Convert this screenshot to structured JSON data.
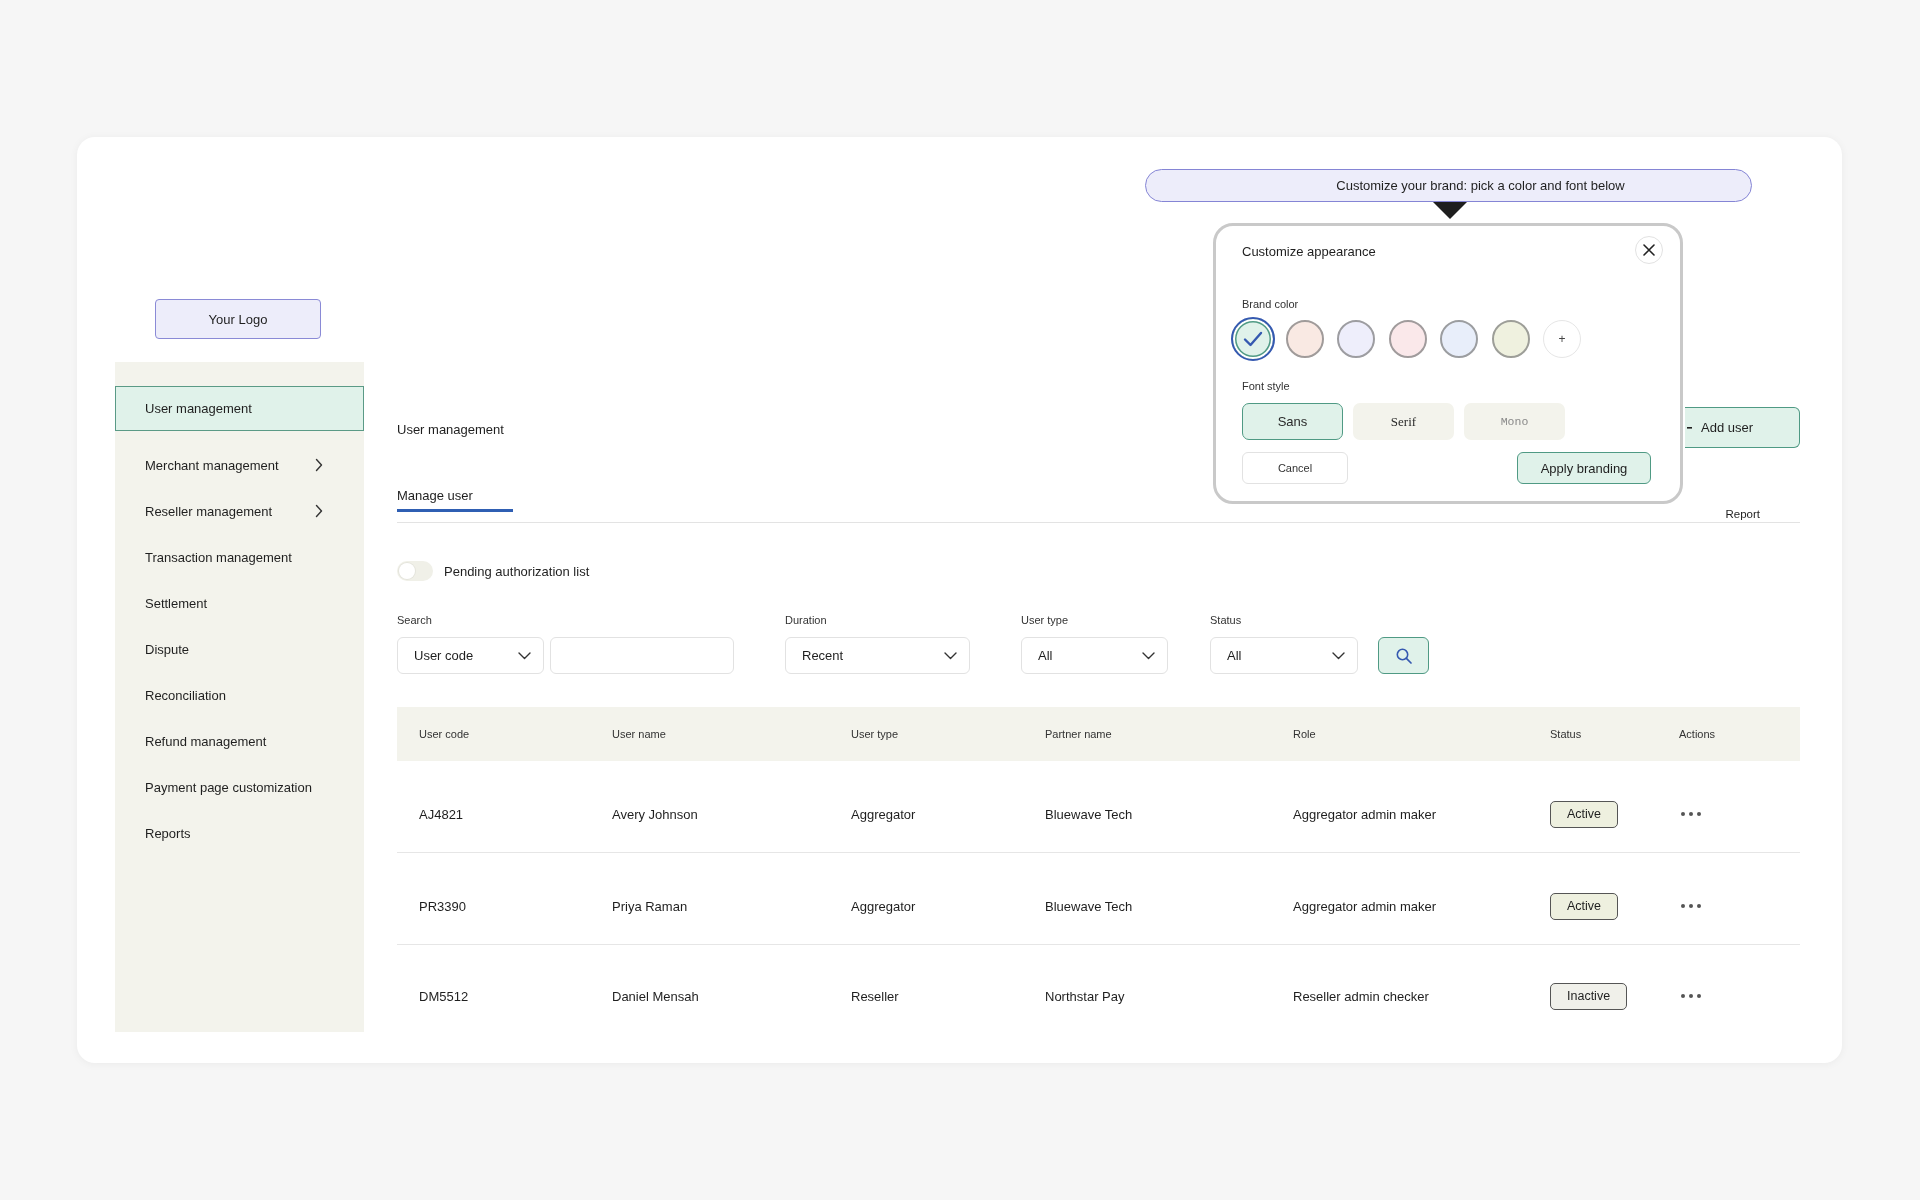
{
  "tooltip": {
    "text": "Customize your brand: pick a color and font below"
  },
  "appearance_dialog": {
    "title": "Customize appearance",
    "brand_color_label": "Brand color",
    "colors": [
      {
        "color": "#e0f2ea",
        "selected": true
      },
      {
        "color": "#f9e9e3",
        "selected": false
      },
      {
        "color": "#eeeefb",
        "selected": false
      },
      {
        "color": "#fae8ea",
        "selected": false
      },
      {
        "color": "#e8eefa",
        "selected": false
      },
      {
        "color": "#eff1df",
        "selected": false
      }
    ],
    "add_color_label": "+",
    "font_style_label": "Font style",
    "font_styles": [
      {
        "kind": "sans",
        "label": "Sans",
        "selected": true,
        "disabled": false
      },
      {
        "kind": "serif",
        "label": "Serif",
        "selected": false,
        "disabled": false
      },
      {
        "kind": "mono",
        "label": "Mono",
        "selected": false,
        "disabled": true
      }
    ],
    "buttons": [
      {
        "kind": "secondary",
        "label": "Cancel"
      },
      {
        "kind": "primary",
        "label": "Apply branding"
      }
    ]
  },
  "logo": {
    "label": "Your Logo"
  },
  "sidebar": {
    "items": [
      {
        "label": "User management",
        "selected": true,
        "has_submenu": false
      },
      {
        "label": "Merchant management",
        "selected": false,
        "has_submenu": true
      },
      {
        "label": "Reseller management",
        "selected": false,
        "has_submenu": true
      },
      {
        "label": "Transaction management",
        "selected": false,
        "has_submenu": false
      },
      {
        "label": "Settlement",
        "selected": false,
        "has_submenu": false
      },
      {
        "label": "Dispute",
        "selected": false,
        "has_submenu": false
      },
      {
        "label": "Reconciliation",
        "selected": false,
        "has_submenu": false
      },
      {
        "label": "Refund management",
        "selected": false,
        "has_submenu": false
      },
      {
        "label": "Payment page customization",
        "selected": false,
        "has_submenu": false
      },
      {
        "label": "Reports",
        "selected": false,
        "has_submenu": false
      }
    ]
  },
  "page": {
    "title": "User management",
    "add_user_button": "Add user"
  },
  "tabs": [
    {
      "label": "Manage user",
      "selected": true
    },
    {
      "label": "Report",
      "selected": false
    }
  ],
  "pending_toggle": {
    "label": "Pending authorization list",
    "on": false
  },
  "filters": [
    {
      "kind": "select_with_input",
      "label": "Search",
      "value": "User code"
    },
    {
      "kind": "select",
      "label": "Duration",
      "value": "Recent"
    },
    {
      "kind": "select",
      "label": "User type",
      "value": "All"
    },
    {
      "kind": "select",
      "label": "Status",
      "value": "All"
    }
  ],
  "table": {
    "columns": [
      "User code",
      "User name",
      "User type",
      "Partner name",
      "Role",
      "Status",
      "Actions"
    ],
    "rows": [
      {
        "cells": [
          "AJ4821",
          "Avery Johnson",
          "Aggregator",
          "Bluewave Tech",
          "Aggregator admin maker"
        ],
        "status": {
          "label": "Active",
          "color": "#eef0df"
        }
      },
      {
        "cells": [
          "PR3390",
          "Priya Raman",
          "Aggregator",
          "Bluewave Tech",
          "Aggregator admin maker"
        ],
        "status": {
          "label": "Active",
          "color": "#eef0df"
        }
      },
      {
        "cells": [
          "DM5512",
          "Daniel Mensah",
          "Reseller",
          "Northstar Pay",
          "Reseller admin checker"
        ],
        "status": {
          "label": "Inactive",
          "color": "#f0f0ea"
        }
      }
    ]
  }
}
